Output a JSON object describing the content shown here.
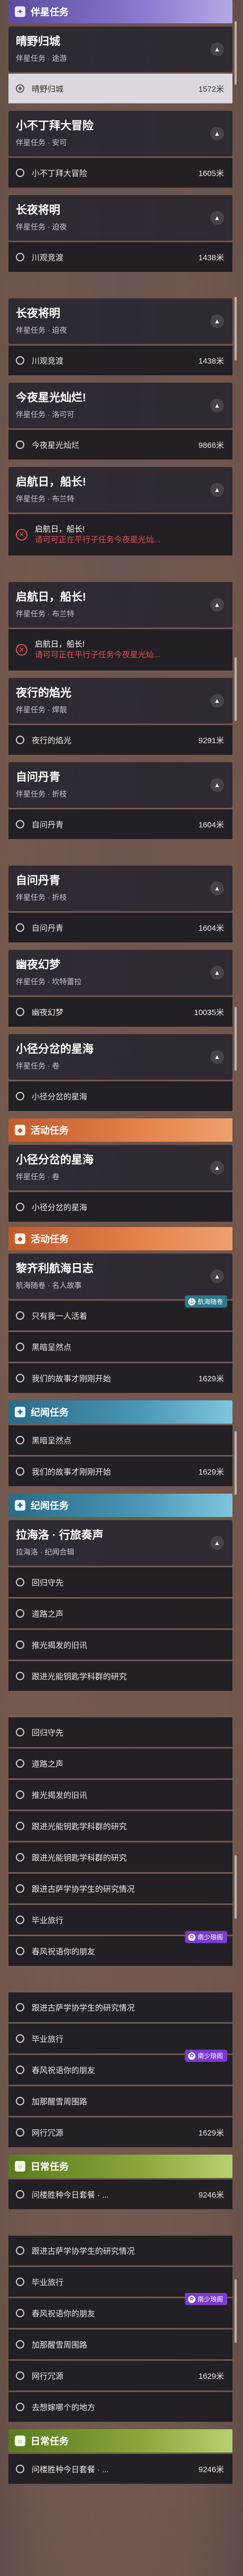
{
  "tags": {
    "trailblaze": "伴星任务",
    "event": "活动任务",
    "companion_mission": "纪闻任务",
    "daily": "日常任务"
  },
  "q": {
    "q1": {
      "title": "晴野归城",
      "sub": "伴星任务 · 途游"
    },
    "q2": {
      "title": "小不丁拜大冒险",
      "sub": "伴星任务 · 安可"
    },
    "q3": {
      "title": "长夜将明",
      "sub": "伴星任务 · 迫夜"
    },
    "q4": {
      "title": "今夜星光灿烂!",
      "sub": "伴星任务 · 洛可可"
    },
    "q5": {
      "title": "启航日，船长!",
      "sub": "伴星任务 · 布兰特"
    },
    "q6": {
      "title": "夜行的焰光",
      "sub": "伴星任务 · 焊靓"
    },
    "q7": {
      "title": "自问丹青",
      "sub": "伴星任务 · 折枝"
    },
    "q8": {
      "title": "幽夜幻梦",
      "sub": "伴星任务 · 坎特蕾拉"
    },
    "q9": {
      "title": "小径分岔的星海",
      "sub": "伴星任务 · 卷"
    },
    "q10": {
      "title": "黎齐利航海日志",
      "sub": "航海随卷 · 名人故事"
    },
    "q11": {
      "title": "拉海洛 · 行旅奏声",
      "sub": "拉海洛 · 纪闻合辑"
    },
    "q12": {
      "title": "日常任务",
      "sub": ""
    }
  },
  "r": {
    "a1": "晴野归城",
    "a2": "小不丁拜大冒险",
    "a3": "川观竞渡",
    "a4": "今夜星光灿烂",
    "a5": "启航日，船长!",
    "a5w": "请可可正在平行子任务今夜星光灿...",
    "a6": "夜行的焰光",
    "a7": "自问丹青",
    "a8": "幽夜幻梦",
    "a9": "小径分岔的星海",
    "e1": "只有我一人活着",
    "e2": "黑暗呈然点",
    "e3": "我们的故事才刚刚开始",
    "m1": "回归守先",
    "m2": "道路之声",
    "m3": "推光揭发的旧讯",
    "m4": "跟进光能钥匙学科群的研究",
    "m5": "跟进光能钥匙学科群的研究",
    "m6": "跟进古萨学协学生的研究情况",
    "m7": "毕业旅行",
    "m8": "春风祝语你的朋友",
    "m9": "加那醒雪周围路",
    "m10": "网行冗源",
    "m11": "去想嫁哪个的地方",
    "d1": "问楼胜种今日套餐 · ...",
    "d2": "问楼胜种今日套餐 · ..."
  },
  "dist": {
    "d1572": "1572米",
    "d1605": "1605米",
    "d1438": "1438米",
    "d9866": "9866米",
    "d9291": "9291米",
    "d1604": "1604米",
    "d10035": "10035米",
    "d1629": "1629米",
    "d9246": "9246米"
  },
  "badges": {
    "b1": "航海随卷",
    "b2": "南少琅阁",
    "b3": "南少琅阁"
  }
}
